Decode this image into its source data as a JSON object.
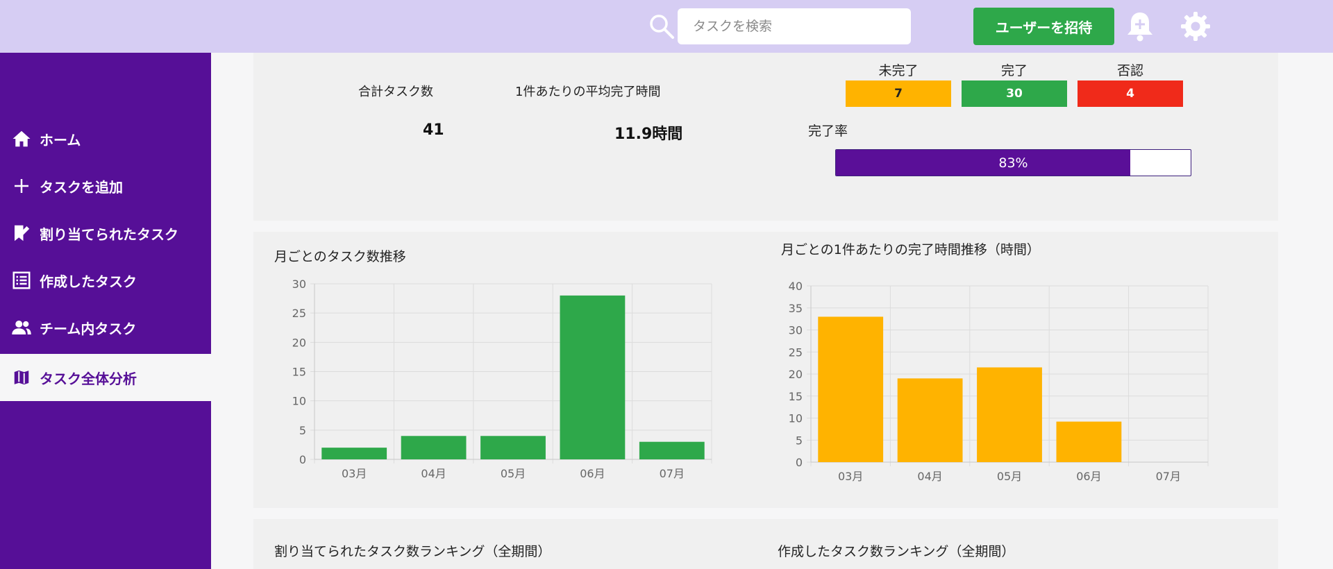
{
  "header": {
    "search_placeholder": "タスクを検索",
    "invite_label": "ユーザーを招待",
    "icons": [
      "search-icon",
      "bell-plus-icon",
      "gear-icon"
    ],
    "background_color": "#d6cdf3"
  },
  "sidebar": {
    "background_color": "#560f97",
    "items": [
      {
        "label": "ホーム",
        "icon": "home-icon",
        "active": false
      },
      {
        "label": "タスクを追加",
        "icon": "plus-icon",
        "active": false
      },
      {
        "label": "割り当てられたタスク",
        "icon": "assigned-icon",
        "active": false
      },
      {
        "label": "作成したタスク",
        "icon": "list-icon",
        "active": false
      },
      {
        "label": "チーム内タスク",
        "icon": "people-icon",
        "active": false
      },
      {
        "label": "タスク全体分析",
        "icon": "map-icon",
        "active": true
      }
    ]
  },
  "stats": {
    "total_label": "合計タスク数",
    "total_value": "41",
    "avg_label": "1件あたりの平均完了時間",
    "avg_value": "11.9時間",
    "status": [
      {
        "label": "未完了",
        "value": "7",
        "color": "#ffb300"
      },
      {
        "label": "完了",
        "value": "30",
        "color": "#2ea84a"
      },
      {
        "label": "否認",
        "value": "4",
        "color": "#f02a1a"
      }
    ],
    "completion_label": "完了率",
    "completion_text": "83%",
    "completion_fraction": 0.83
  },
  "rankings": {
    "assigned_title": "割り当てられたタスク数ランキング（全期間）",
    "created_title": "作成したタスク数ランキング（全期間）"
  },
  "chart_data": [
    {
      "type": "bar",
      "title": "月ごとのタスク数推移",
      "categories": [
        "03月",
        "04月",
        "05月",
        "06月",
        "07月"
      ],
      "values": [
        2,
        4,
        4,
        28,
        3
      ],
      "ylim": [
        0,
        30
      ],
      "yticks": [
        0,
        5,
        10,
        15,
        20,
        25,
        30
      ],
      "color": "#2ea84a",
      "grid": true
    },
    {
      "type": "bar",
      "title": "月ごとの1件あたりの完了時間推移（時間）",
      "categories": [
        "03月",
        "04月",
        "05月",
        "06月",
        "07月"
      ],
      "values": [
        33,
        19,
        21.5,
        9.2,
        0
      ],
      "ylim": [
        0,
        40
      ],
      "yticks": [
        0,
        5,
        10,
        15,
        20,
        25,
        30,
        35,
        40
      ],
      "color": "#ffb300",
      "grid": true
    }
  ]
}
